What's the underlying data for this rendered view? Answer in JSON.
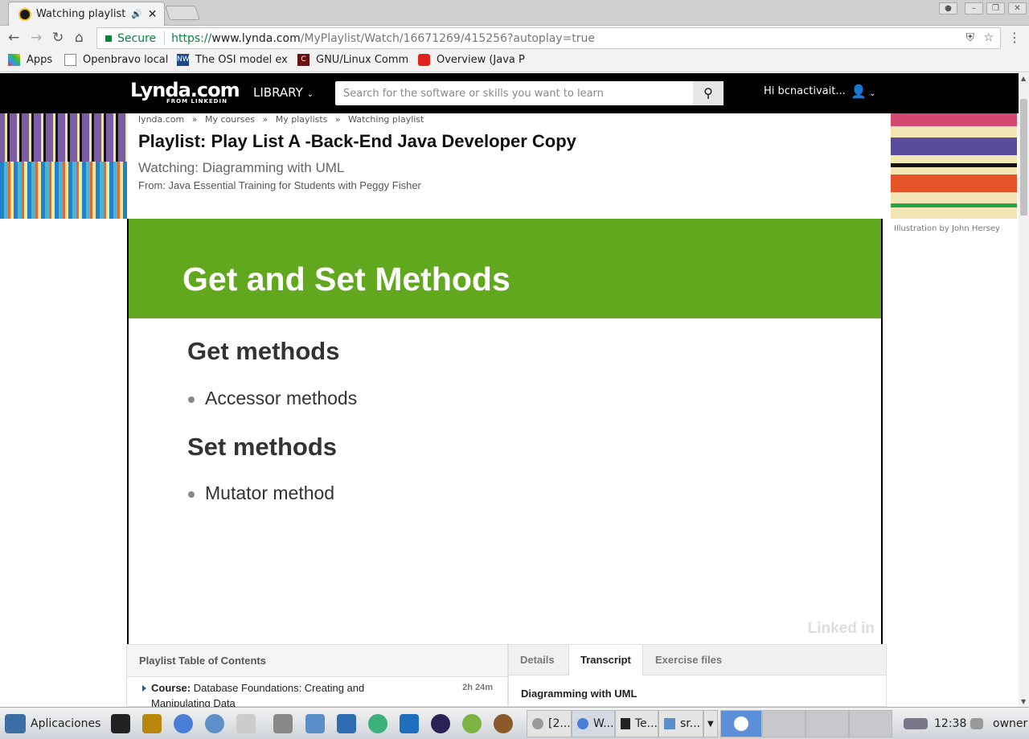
{
  "browser": {
    "tab_title": "Watching playlist",
    "url_scheme": "https://",
    "url_host": "www.lynda.com",
    "url_path": "/MyPlaylist/Watch/16671269/415256?autoplay=true",
    "secure_label": "Secure",
    "bookmarks": [
      "Apps",
      "Openbravo local",
      "The OSI model ex",
      "GNU/Linux Comm",
      "Overview (Java P"
    ]
  },
  "site": {
    "logo": "Lynda.com",
    "logo_sub": "FROM LINKEDIN",
    "library": "LIBRARY",
    "search_placeholder": "Search for the software or skills you want to learn",
    "greeting": "Hi bcnactivait..."
  },
  "breadcrumb": [
    "lynda.com",
    "»",
    "My courses",
    "»",
    "My playlists",
    "»",
    "Watching playlist"
  ],
  "page": {
    "title": "Playlist: Play List A -Back-End Java Developer Copy",
    "watching": "Watching: Diagramming with UML",
    "from": "From: Java Essential Training for Students with Peggy Fisher",
    "credit": "Illustration by John Hersey"
  },
  "video": {
    "slide_title": "Get and Set Methods",
    "heading1": "Get methods",
    "bullet1": "Accessor methods",
    "heading2": "Set methods",
    "bullet2": "Mutator method",
    "watermark": "Linked in"
  },
  "toc": {
    "header": "Playlist Table of Contents",
    "item_label": "Course:",
    "item_title": "Database Foundations: Creating and Manipulating Data",
    "item_duration": "2h 24m"
  },
  "panel": {
    "tabs": [
      "Details",
      "Transcript",
      "Exercise files"
    ],
    "active_tab": "Transcript",
    "content_title": "Diagramming with UML"
  },
  "taskbar": {
    "apps_label": "Aplicaciones",
    "windows": [
      "[2...",
      "W...",
      "Te...",
      "sr..."
    ],
    "time": "12:38",
    "user": "owner"
  }
}
